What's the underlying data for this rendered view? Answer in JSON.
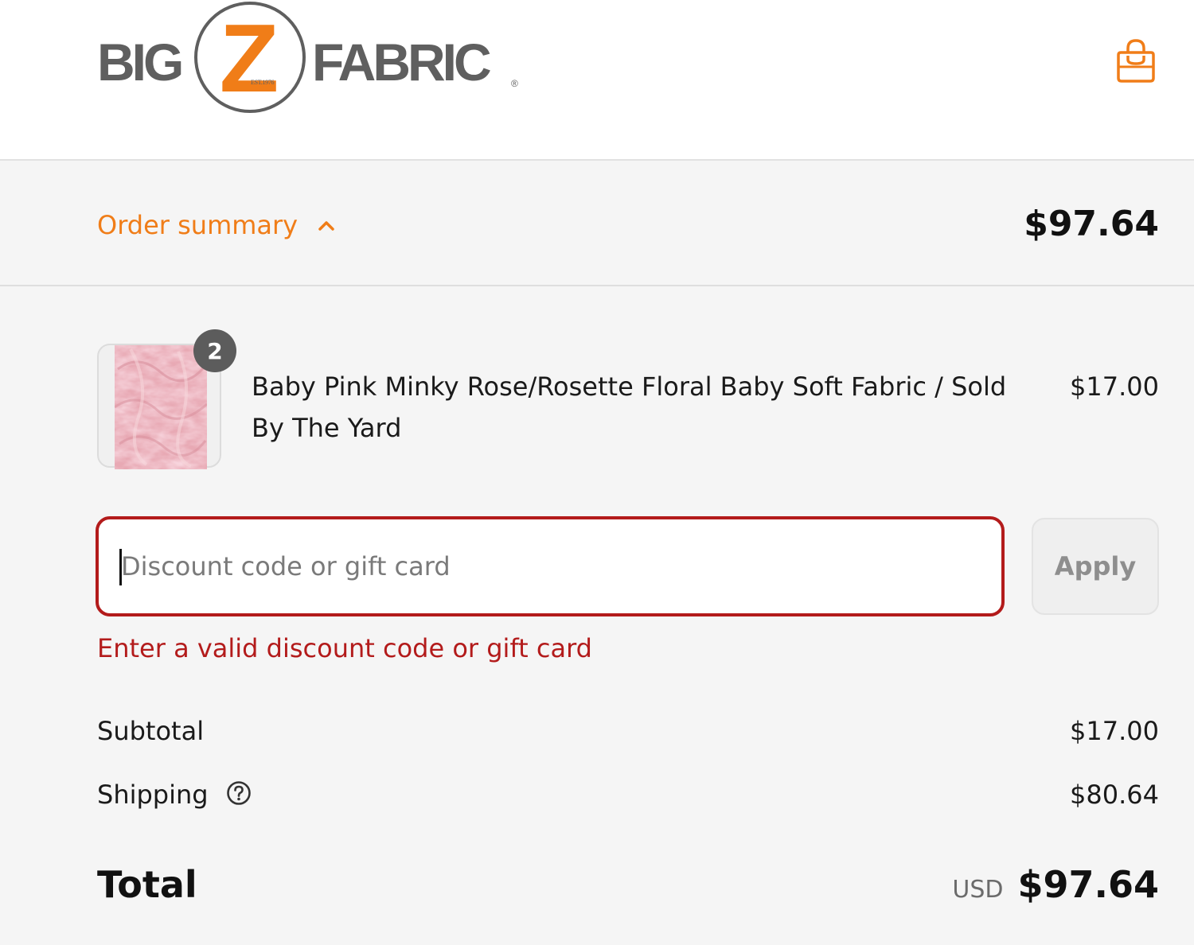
{
  "brand": {
    "logo_left": "BIG",
    "logo_letter": "Z",
    "logo_right": "FABRIC",
    "logo_est": "EST.1976",
    "logo_reg": "®",
    "accent_color": "#f07d18"
  },
  "header": {
    "cart_icon": "shopping-bag-icon"
  },
  "summary": {
    "toggle_label": "Order summary",
    "toggle_icon": "chevron-up-icon",
    "total": "$97.64"
  },
  "line_item": {
    "quantity": "2",
    "name": "Baby Pink Minky Rose/Rosette Floral Baby Soft Fabric / Sold By The Yard",
    "price": "$17.00",
    "image": "pink-minky-fabric-thumbnail"
  },
  "discount": {
    "placeholder": "Discount code or gift card",
    "value": "",
    "apply_label": "Apply",
    "error": "Enter a valid discount code or gift card",
    "error_color": "#b31b1b"
  },
  "costs": {
    "subtotal_label": "Subtotal",
    "subtotal_value": "$17.00",
    "shipping_label": "Shipping",
    "shipping_help_icon": "question-circle-icon",
    "shipping_value": "$80.64",
    "total_label": "Total",
    "currency": "USD",
    "total_value": "$97.64"
  }
}
